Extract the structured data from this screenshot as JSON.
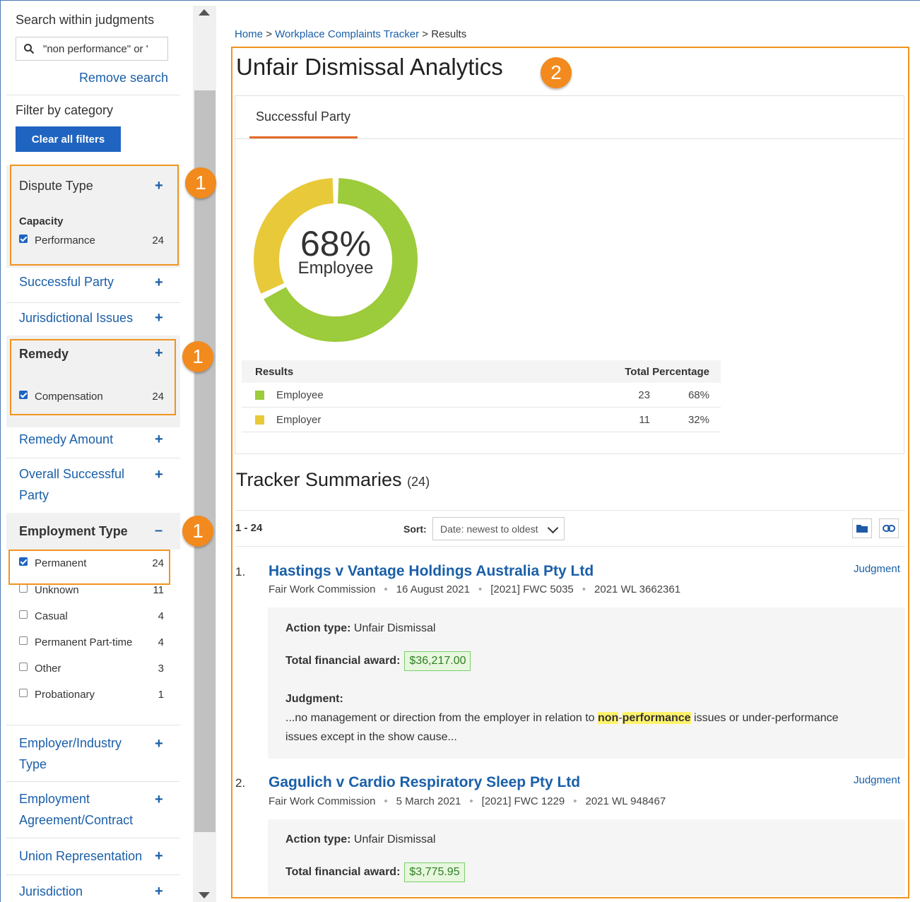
{
  "sidebar": {
    "search_title": "Search within judgments",
    "search_value": "\"non performance\" or '",
    "remove_search": "Remove search",
    "filter_title": "Filter by category",
    "clear_filters": "Clear all filters",
    "dispute_type": {
      "label": "Dispute Type",
      "sub": "Capacity",
      "option": "Performance",
      "count": "24"
    },
    "successful_party": "Successful Party",
    "jurisdictional_issues": "Jurisdictional Issues",
    "remedy": {
      "label": "Remedy",
      "option": "Compensation",
      "count": "24"
    },
    "remedy_amount": "Remedy Amount",
    "overall_line1": "Overall Successful",
    "overall_line2": "Party",
    "employment_type": {
      "label": "Employment Type",
      "options": [
        {
          "label": "Permanent",
          "count": "24",
          "checked": true
        },
        {
          "label": "Unknown",
          "count": "11",
          "checked": false
        },
        {
          "label": "Casual",
          "count": "4",
          "checked": false
        },
        {
          "label": "Permanent Part-time",
          "count": "4",
          "checked": false
        },
        {
          "label": "Other",
          "count": "3",
          "checked": false
        },
        {
          "label": "Probationary",
          "count": "1",
          "checked": false
        }
      ]
    },
    "employer_line1": "Employer/Industry",
    "employer_line2": "Type",
    "agreement_line1": "Employment",
    "agreement_line2": "Agreement/Contract",
    "union": "Union Representation",
    "jurisdiction": "Jurisdiction",
    "plus": "+",
    "minus": "–"
  },
  "badges": {
    "one": "1",
    "two": "2"
  },
  "breadcrumb": {
    "home": "Home",
    "tracker": "Workplace Complaints Tracker",
    "current": "Results",
    "sep": ">"
  },
  "main": {
    "title": "Unfair Dismissal Analytics",
    "tab": "Successful Party",
    "donut_pct": "68%",
    "donut_label": "Employee",
    "table": {
      "col_results": "Results",
      "col_total_pct": "Total Percentage",
      "rows": [
        {
          "label": "Employee",
          "total": "23",
          "pct": "68%",
          "color": "#9ccb3b"
        },
        {
          "label": "Employer",
          "total": "11",
          "pct": "32%",
          "color": "#e8c93a"
        }
      ]
    },
    "tracker_title": "Tracker Summaries",
    "tracker_count": "(24)",
    "range": "1 - 24",
    "sort_label": "Sort:",
    "sort_value": "Date: newest to oldest",
    "items": [
      {
        "num": "1.",
        "title": "Hastings v Vantage Holdings Australia Pty Ltd",
        "court": "Fair Work Commission",
        "date": "16 August 2021",
        "citation": "[2021] FWC 5035",
        "wl": "2021 WL 3662361",
        "link": "Judgment",
        "action_label": "Action type:",
        "action_value": "Unfair Dismissal",
        "award_label": "Total financial award:",
        "award_value": "$36,217.00",
        "judgment_label": "Judgment:",
        "excerpt_pre": "...no management or direction from the employer in relation to ",
        "hl1": "non",
        "hl_dash": "-",
        "hl2": "performance",
        "excerpt_post": " issues or under-performance",
        "excerpt_line2": "issues except in the show cause..."
      },
      {
        "num": "2.",
        "title": "Gagulich v Cardio Respiratory Sleep Pty Ltd",
        "court": "Fair Work Commission",
        "date": "5 March 2021",
        "citation": "[2021] FWC 1229",
        "wl": "2021 WL 948467",
        "link": "Judgment",
        "action_label": "Action type:",
        "action_value": "Unfair Dismissal",
        "award_label": "Total financial award:",
        "award_value": "$3,775.95"
      }
    ]
  },
  "chart_data": {
    "type": "pie",
    "categories": [
      "Employee",
      "Employer"
    ],
    "values": [
      23,
      11
    ],
    "percentages": [
      68,
      32
    ],
    "colors": [
      "#9ccb3b",
      "#e8c93a"
    ]
  }
}
